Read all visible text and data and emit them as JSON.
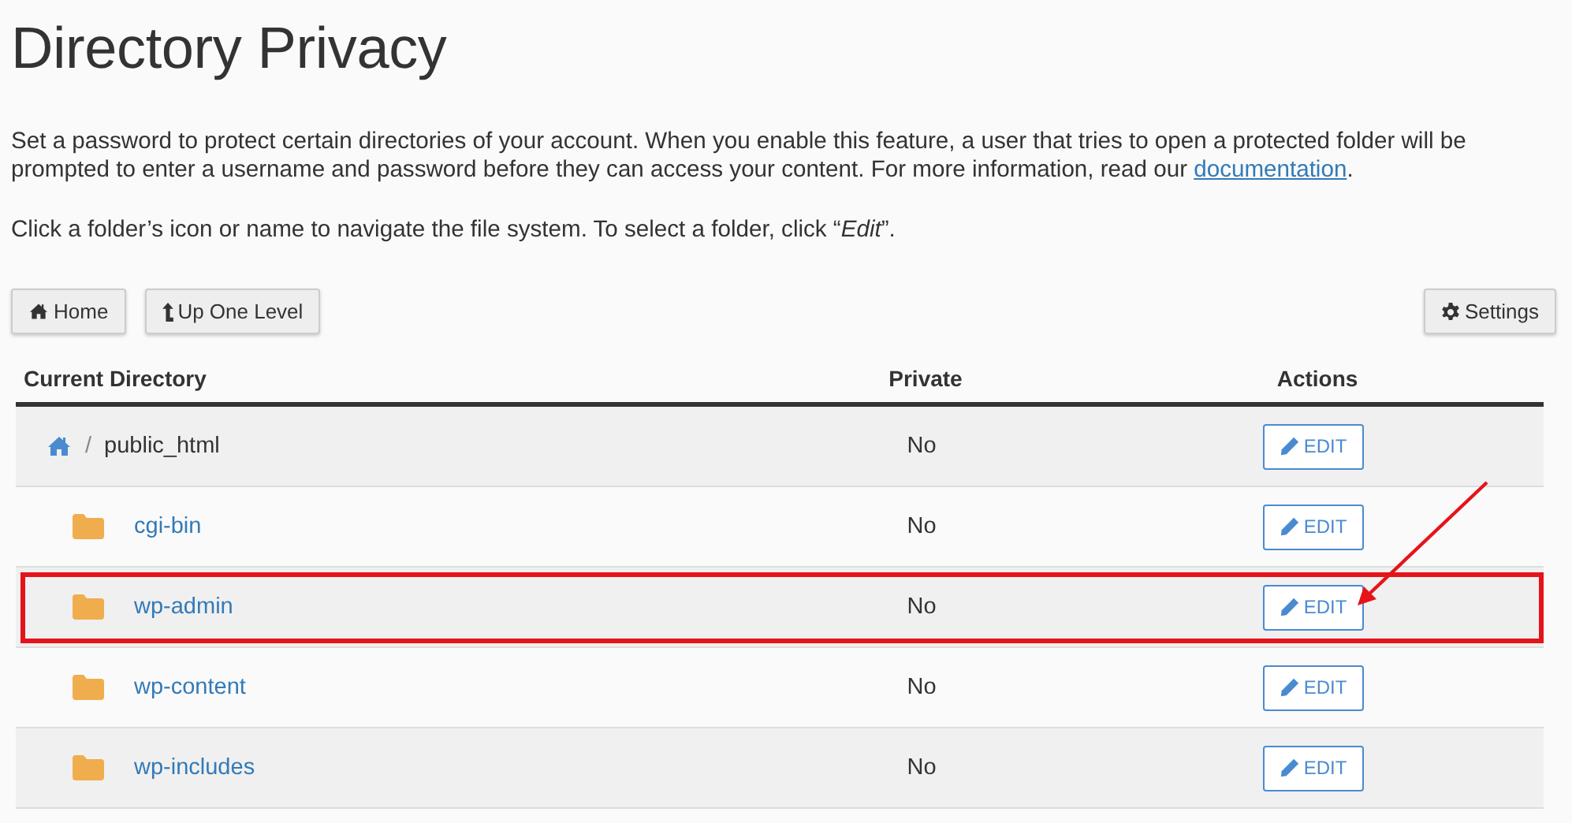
{
  "title": "Directory Privacy",
  "intro": {
    "text_before": "Set a password to protect certain directories of your account. When you enable this feature, a user that tries to open a protected folder will be prompted to enter a username and password before they can access your content. For more information, read our ",
    "link": "documentation",
    "text_after": "."
  },
  "hint": "Click a folder’s icon or name to navigate the file system. To select a folder, click “*Edit*”.",
  "toolbar": {
    "left": [
      {
        "kind": "home",
        "label": "Home"
      },
      {
        "kind": "up",
        "label": "Up One Level"
      }
    ],
    "right": [
      {
        "kind": "settings",
        "label": "Settings"
      }
    ]
  },
  "table": {
    "columns": [
      "Current Directory",
      "Private",
      "Actions"
    ],
    "rows": [
      {
        "kind": "current",
        "separator": "/",
        "name": "public_html",
        "private": "No",
        "action": "EDIT",
        "highlighted": false
      },
      {
        "kind": "folder",
        "name": "cgi-bin",
        "private": "No",
        "action": "EDIT",
        "highlighted": false
      },
      {
        "kind": "folder",
        "name": "wp-admin",
        "private": "No",
        "action": "EDIT",
        "highlighted": true
      },
      {
        "kind": "folder",
        "name": "wp-content",
        "private": "No",
        "action": "EDIT",
        "highlighted": false
      },
      {
        "kind": "folder",
        "name": "wp-includes",
        "private": "No",
        "action": "EDIT",
        "highlighted": false
      }
    ]
  }
}
